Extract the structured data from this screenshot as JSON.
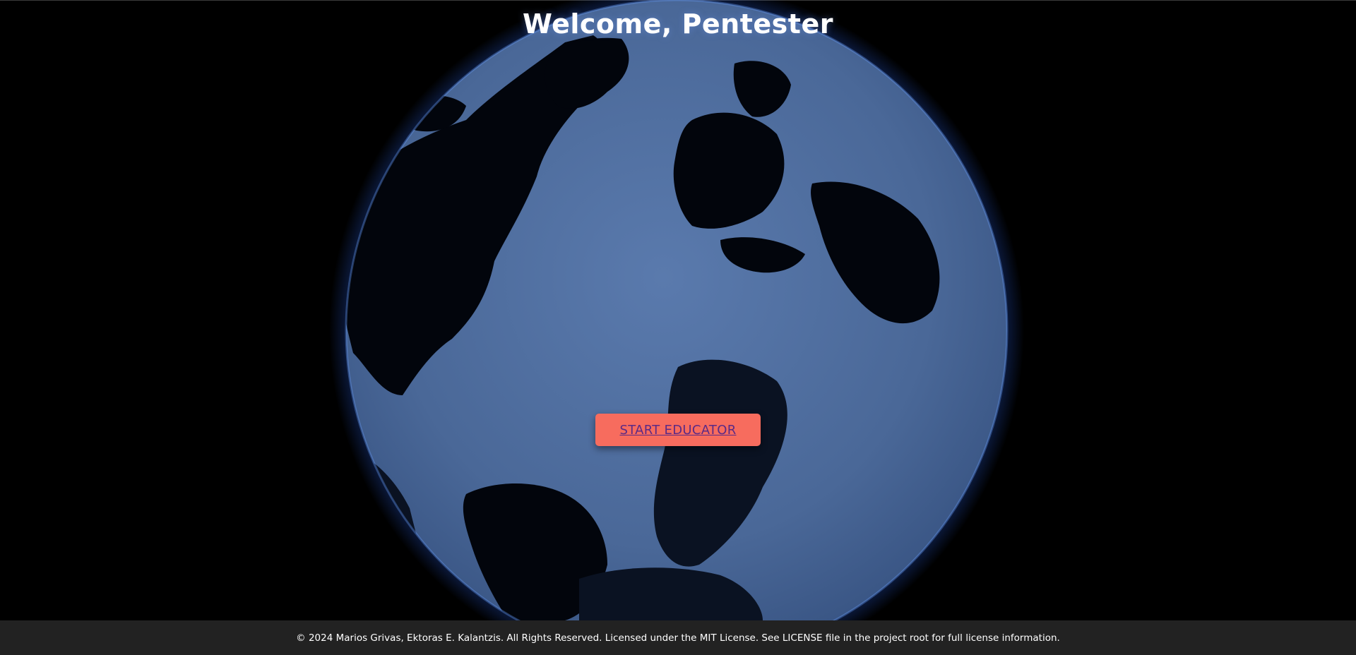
{
  "page": {
    "title": "Welcome, Pentester"
  },
  "hero": {
    "globe_icon": "earth-globe-icon",
    "cta_label": "START EDUCATOR"
  },
  "footer": {
    "text": "© 2024 Marios Grivas, Ektoras E. Kalantzis. All Rights Reserved. Licensed under the MIT License. See LICENSE file in the project root for full license information."
  },
  "colors": {
    "background": "#000000",
    "globe_ocean": "#4a6898",
    "globe_land": "#02050c",
    "globe_glow": "#2f6bff",
    "cta_background": "#f76c5e",
    "cta_text": "#5b2a86",
    "footer_background": "#222222",
    "title_text": "#ffffff"
  }
}
